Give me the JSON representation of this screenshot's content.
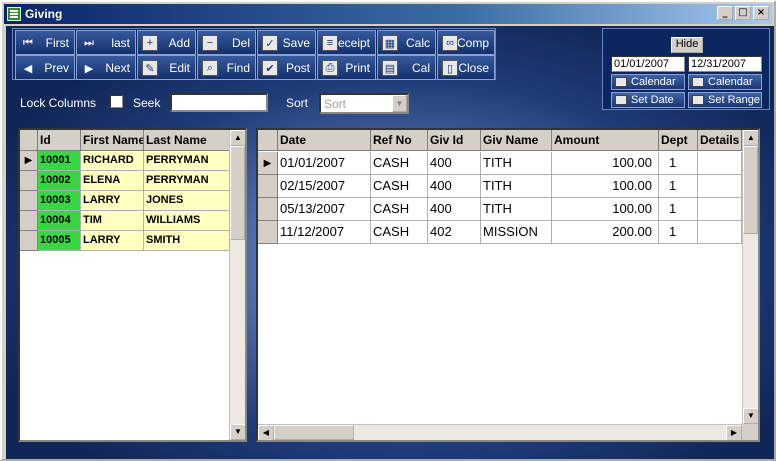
{
  "window": {
    "title": "Giving",
    "minimize": "_",
    "maximize": "□",
    "close": "×"
  },
  "toolbar": {
    "row1": [
      {
        "name": "first-button",
        "icon": "first-icon",
        "glyph": "⏮",
        "label": "First"
      },
      {
        "name": "last-button",
        "icon": "last-icon",
        "glyph": "⏭",
        "label": "last"
      },
      {
        "name": "add-button",
        "icon": "add-record-icon",
        "glyph": "+",
        "label": "Add"
      },
      {
        "name": "delete-button",
        "icon": "delete-record-icon",
        "glyph": "−",
        "label": "Del"
      },
      {
        "name": "save-button",
        "icon": "save-check-icon",
        "glyph": "✓",
        "label": "Save"
      },
      {
        "name": "receipt-button",
        "icon": "receipt-icon",
        "glyph": "≡",
        "label": "Receipt"
      },
      {
        "name": "calc-button",
        "icon": "calculator-icon",
        "glyph": "▦",
        "label": "Calc"
      },
      {
        "name": "comp-button",
        "icon": "link-icon",
        "glyph": "∞",
        "label": "Comp"
      }
    ],
    "row2": [
      {
        "name": "prev-button",
        "icon": "prev-arrow-icon",
        "glyph": "◀",
        "label": "Prev"
      },
      {
        "name": "next-button",
        "icon": "next-arrow-icon",
        "glyph": "▶",
        "label": "Next"
      },
      {
        "name": "edit-button",
        "icon": "edit-pencil-icon",
        "glyph": "✎",
        "label": "Edit"
      },
      {
        "name": "find-button",
        "icon": "find-icon",
        "glyph": "⌕",
        "label": "Find"
      },
      {
        "name": "post-button",
        "icon": "post-check-icon",
        "glyph": "✔",
        "label": "Post"
      },
      {
        "name": "print-button",
        "icon": "printer-icon",
        "glyph": "⎙",
        "label": "Print"
      },
      {
        "name": "cal-button",
        "icon": "calendar-icon",
        "glyph": "▤",
        "label": "Cal"
      },
      {
        "name": "close-button",
        "icon": "door-icon",
        "glyph": "▯",
        "label": "Close"
      }
    ]
  },
  "daterange": {
    "hide_label": "Hide",
    "start_date": "01/01/2007",
    "end_date": "12/31/2007",
    "calendar_label": "Calendar",
    "set_date_label": "Set Date",
    "set_range_label": "Set Range"
  },
  "options": {
    "lock_columns_label": "Lock Columns",
    "seek_label": "Seek",
    "seek_value": "",
    "sort_label": "Sort",
    "sort_value": "Sort"
  },
  "members": {
    "columns": [
      "Id",
      "First Name",
      "Last Name"
    ],
    "rows": [
      [
        "10001",
        "RICHARD",
        "PERRYMAN"
      ],
      [
        "10002",
        "ELENA",
        "PERRYMAN"
      ],
      [
        "10003",
        "LARRY",
        "JONES"
      ],
      [
        "10004",
        "TIM",
        "WILLIAMS"
      ],
      [
        "10005",
        "LARRY",
        "SMITH"
      ]
    ]
  },
  "gifts": {
    "columns": [
      "Date",
      "Ref No",
      "Giv Id",
      "Giv Name",
      "Amount",
      "Dept",
      "Details"
    ],
    "rows": [
      [
        "01/01/2007",
        "CASH",
        "400",
        "TITH",
        "100.00",
        "1",
        ""
      ],
      [
        "02/15/2007",
        "CASH",
        "400",
        "TITH",
        "100.00",
        "1",
        ""
      ],
      [
        "05/13/2007",
        "CASH",
        "400",
        "TITH",
        "100.00",
        "1",
        ""
      ],
      [
        "11/12/2007",
        "CASH",
        "402",
        "MISSION",
        "200.00",
        "1",
        ""
      ]
    ]
  },
  "colors": {
    "id_column": "#37d642",
    "name_columns": "#ffffc0",
    "panel": "#0c2660"
  }
}
